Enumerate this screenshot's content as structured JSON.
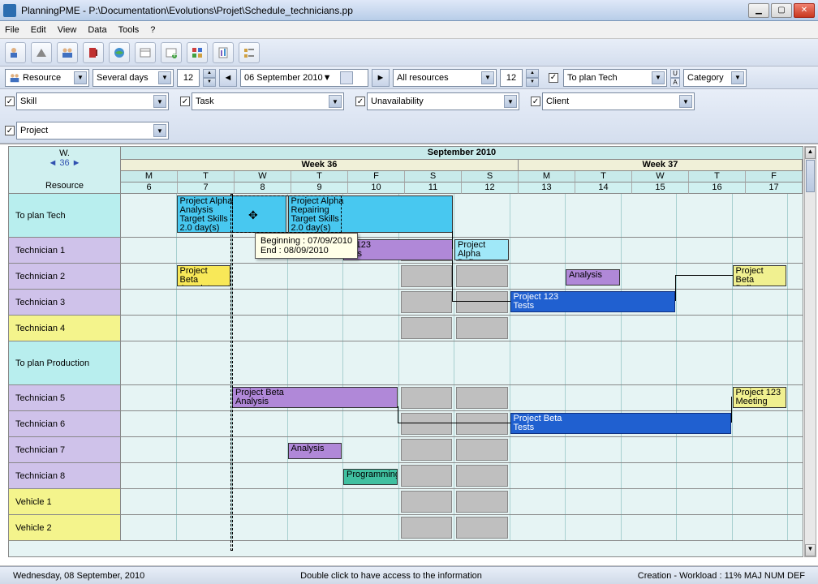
{
  "window": {
    "title": "PlanningPME - P:\\Documentation\\Evolutions\\Projet\\Schedule_technicians.pp"
  },
  "menu": {
    "file": "File",
    "edit": "Edit",
    "view": "View",
    "data": "Data",
    "tools": "Tools",
    "help": "?"
  },
  "tb2": {
    "resource": "Resource",
    "view": "Several days",
    "leftnum": "12",
    "date": "06 September 2010",
    "allres": "All resources",
    "rightnum": "12",
    "toplan": "To plan Tech",
    "category": "Category"
  },
  "filters": {
    "skill": "Skill",
    "task": "Task",
    "unavail": "Unavailability",
    "client": "Client",
    "project": "Project"
  },
  "sched": {
    "wlabel": "W.",
    "wnav": "◄ 36 ►",
    "reslabel": "Resource",
    "month": "September 2010",
    "week36": "Week 36",
    "week37": "Week 37",
    "days": [
      "M",
      "T",
      "W",
      "T",
      "F",
      "S",
      "S",
      "M",
      "T",
      "W",
      "T",
      "F"
    ],
    "nums": [
      "6",
      "7",
      "8",
      "9",
      "10",
      "11",
      "12",
      "13",
      "14",
      "15",
      "16",
      "17"
    ]
  },
  "rows": {
    "toplan_tech": "To plan Tech",
    "t1": "Technician 1",
    "t2": "Technician 2",
    "t3": "Technician 3",
    "t4": "Technician 4",
    "toplan_prod": "To plan Production",
    "t5": "Technician 5",
    "t6": "Technician 6",
    "t7": "Technician 7",
    "t8": "Technician 8",
    "v1": "Vehicle 1",
    "v2": "Vehicle 2"
  },
  "tasks": {
    "alpha_analysis_line1": "Project Alpha",
    "alpha_analysis_line2": "Analysis",
    "alpha_analysis_line3": "Target Skills",
    "alpha_analysis_line4": "2.0 day(s)",
    "alpha_repair_line1": "Project Alpha",
    "alpha_repair_line2": "Repairing",
    "alpha_repair_line3": "Target Skills",
    "alpha_repair_line4": "2.0 day(s)",
    "p123_line1": "ct 123",
    "p123_line2": "ysis",
    "alpha_delivery_line1": "Project Alpha",
    "alpha_delivery_line2": "Delivery",
    "beta_appt_line1": "Project Beta",
    "beta_appt_line2": "Appointment",
    "analysis_only": "Analysis",
    "p123_tests_line1": "Project 123",
    "p123_tests_line2": "Tests",
    "beta_delivery_line1": "Project Beta",
    "beta_delivery_line2": "Delivery",
    "beta_analysis_line1": "Project Beta",
    "beta_analysis_line2": "Analysis",
    "p123_meeting_line1": "Project 123",
    "p123_meeting_line2": "Meeting",
    "beta_tests_line1": "Project Beta",
    "beta_tests_line2": "Tests",
    "programming": "Programming"
  },
  "tooltip": {
    "line1": "Beginning : 07/09/2010",
    "line2": "End : 08/09/2010"
  },
  "status": {
    "date": "Wednesday, 08 September, 2010",
    "hint": "Double click to have access to the information",
    "right": "Creation - Workload : 11%  MAJ   NUM   DEF"
  }
}
